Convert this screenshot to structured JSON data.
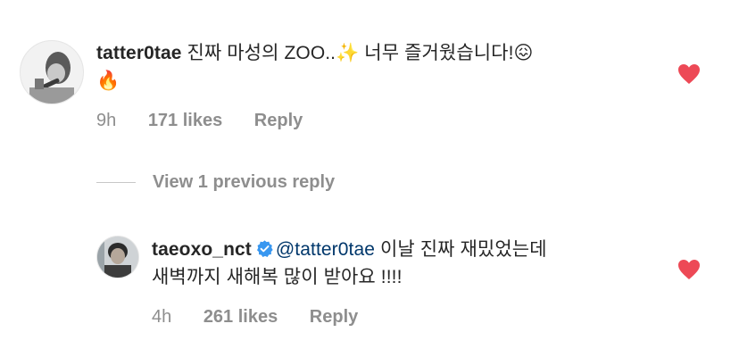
{
  "comments": [
    {
      "username": "tatter0tae",
      "text_part1": "진짜 마성의 ZOO..",
      "emoji_sparkles": "✨",
      "text_part2": " 너무 즐거웠습니다!",
      "emoji_confounded": "😖",
      "emoji_fire": "🔥",
      "time": "9h",
      "likes": "171 likes",
      "reply": "Reply",
      "liked": true,
      "heart_color": "#ed4956"
    },
    {
      "username": "taeoxo_nct",
      "verified": true,
      "mention": "@tatter0tae",
      "text_line1": " 이날 진짜 재밌었는데",
      "text_line2": "새벽까지 새해복 많이 받아요 !!!!",
      "time": "4h",
      "likes": "261 likes",
      "reply": "Reply",
      "liked": true,
      "heart_color": "#ed4956"
    }
  ],
  "view_previous_replies": "View 1 previous reply",
  "colors": {
    "text": "#262626",
    "muted": "#8e8e8e",
    "mention": "#00376b",
    "verified": "#3897f0",
    "heart": "#ed4956"
  },
  "icons": [
    "verified-badge-icon",
    "heart-filled-icon"
  ]
}
